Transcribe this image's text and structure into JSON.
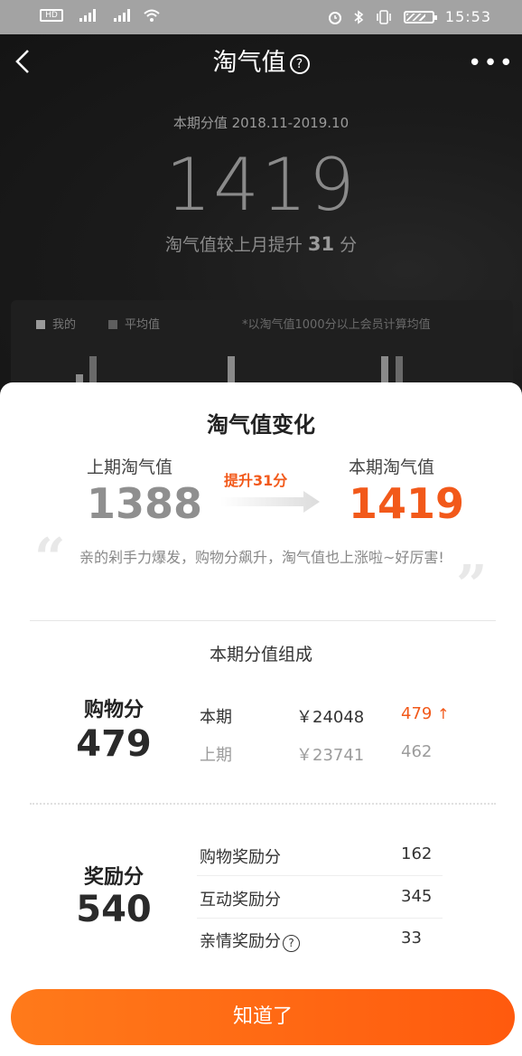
{
  "status_bar": {
    "left_icons": [
      "sim-icon",
      "signal-4g-icon",
      "signal-4g-icon",
      "wifi-icon"
    ],
    "alarm_icon": "alarm-icon",
    "bluetooth_icon": "bluetooth-icon",
    "vibrate_icon": "vibrate-icon",
    "battery_icon": "battery-icon",
    "time": "15:53"
  },
  "nav": {
    "back_icon": "chevron-left-icon",
    "title": "淘气值",
    "help_glyph": "?",
    "more_glyph": "•••"
  },
  "summary": {
    "period": "本期分值 2018.11-2019.10",
    "score": "1419",
    "increase_prefix": "淘气值较上月提升",
    "increase_value": "31",
    "increase_suffix": "分"
  },
  "chart": {
    "legend_mine": "我的",
    "legend_average": "平均值",
    "note": "*以淘气值1000分以上会员计算均值",
    "colors": {
      "mine": "#9a9a9a",
      "average": "#5e5e5e"
    }
  },
  "change_card": {
    "title": "淘气值变化",
    "prev_label": "上期淘气值",
    "prev_value": "1388",
    "rise_label": "提升31分",
    "curr_label": "本期淘气值",
    "curr_value": "1419",
    "praise": "亲的剁手力爆发，购物分飙升，淘气值也上涨啦~好厉害!",
    "accent_color": "#f2591a"
  },
  "composition": {
    "title": "本期分值组成",
    "shopping": {
      "label": "购物分",
      "value": "479",
      "rows": [
        {
          "period": "本期",
          "amount": "￥24048",
          "score": "479",
          "trend": "↑"
        },
        {
          "period": "上期",
          "amount": "￥23741",
          "score": "462"
        }
      ]
    },
    "reward": {
      "label": "奖励分",
      "value": "540",
      "rows": [
        {
          "name": "购物奖励分",
          "score": "162"
        },
        {
          "name": "互动奖励分",
          "score": "345"
        },
        {
          "name": "亲情奖励分",
          "score": "33",
          "help": "?"
        }
      ]
    }
  },
  "button": {
    "label": "知道了"
  }
}
